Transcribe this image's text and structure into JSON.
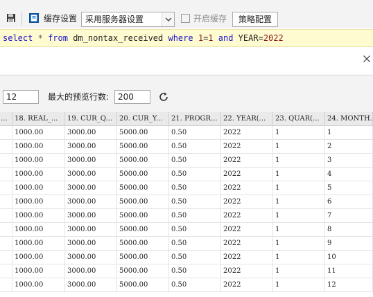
{
  "toolbar": {
    "cache_settings_label": "缓存设置",
    "cache_mode_value": "采用服务器设置",
    "enable_cache_label": "开启缓存",
    "strategy_button_label": "策略配置"
  },
  "sql": {
    "tokens": [
      {
        "text": "select",
        "kind": "kw"
      },
      {
        "text": " ",
        "kind": "plain"
      },
      {
        "text": "*",
        "kind": "sym"
      },
      {
        "text": " ",
        "kind": "plain"
      },
      {
        "text": "from",
        "kind": "kw"
      },
      {
        "text": " dm_nontax_received ",
        "kind": "plain"
      },
      {
        "text": "where",
        "kind": "kw"
      },
      {
        "text": " ",
        "kind": "plain"
      },
      {
        "text": "1",
        "kind": "num"
      },
      {
        "text": "=",
        "kind": "plain"
      },
      {
        "text": "1",
        "kind": "num"
      },
      {
        "text": " ",
        "kind": "plain"
      },
      {
        "text": "and",
        "kind": "kw"
      },
      {
        "text": " YEAR=",
        "kind": "plain"
      },
      {
        "text": "2022",
        "kind": "num"
      }
    ]
  },
  "limits": {
    "limit_value": "12",
    "max_preview_label": "最大的预览行数:",
    "max_preview_value": "200"
  },
  "grid": {
    "headers": [
      "18. REAL_...",
      "19. CUR_Q...",
      "20. CUR_Y...",
      "21. PROGR...",
      "22. YEAR(...",
      "23. QUAR(...",
      "24. MONTH..."
    ],
    "first_header_fragment": "...",
    "rows": [
      [
        "1000.00",
        "3000.00",
        "5000.00",
        "0.50",
        "2022",
        "1",
        "1"
      ],
      [
        "1000.00",
        "3000.00",
        "5000.00",
        "0.50",
        "2022",
        "1",
        "2"
      ],
      [
        "1000.00",
        "3000.00",
        "5000.00",
        "0.50",
        "2022",
        "1",
        "3"
      ],
      [
        "1000.00",
        "3000.00",
        "5000.00",
        "0.50",
        "2022",
        "1",
        "4"
      ],
      [
        "1000.00",
        "3000.00",
        "5000.00",
        "0.50",
        "2022",
        "1",
        "5"
      ],
      [
        "1000.00",
        "3000.00",
        "5000.00",
        "0.50",
        "2022",
        "1",
        "6"
      ],
      [
        "1000.00",
        "3000.00",
        "5000.00",
        "0.50",
        "2022",
        "1",
        "7"
      ],
      [
        "1000.00",
        "3000.00",
        "5000.00",
        "0.50",
        "2022",
        "1",
        "8"
      ],
      [
        "1000.00",
        "3000.00",
        "5000.00",
        "0.50",
        "2022",
        "1",
        "9"
      ],
      [
        "1000.00",
        "3000.00",
        "5000.00",
        "0.50",
        "2022",
        "1",
        "10"
      ],
      [
        "1000.00",
        "3000.00",
        "5000.00",
        "0.50",
        "2022",
        "1",
        "11"
      ],
      [
        "1000.00",
        "3000.00",
        "5000.00",
        "0.50",
        "2022",
        "1",
        "12"
      ]
    ]
  },
  "icons": {
    "save": "floppy-disk-icon",
    "cache": "cache-settings-icon",
    "close": "close-icon",
    "refresh": "refresh-icon"
  },
  "colors": {
    "sql_keyword": "#1c14c8",
    "sql_number": "#8b1a1a",
    "sql_bg": "#fffbd1"
  }
}
